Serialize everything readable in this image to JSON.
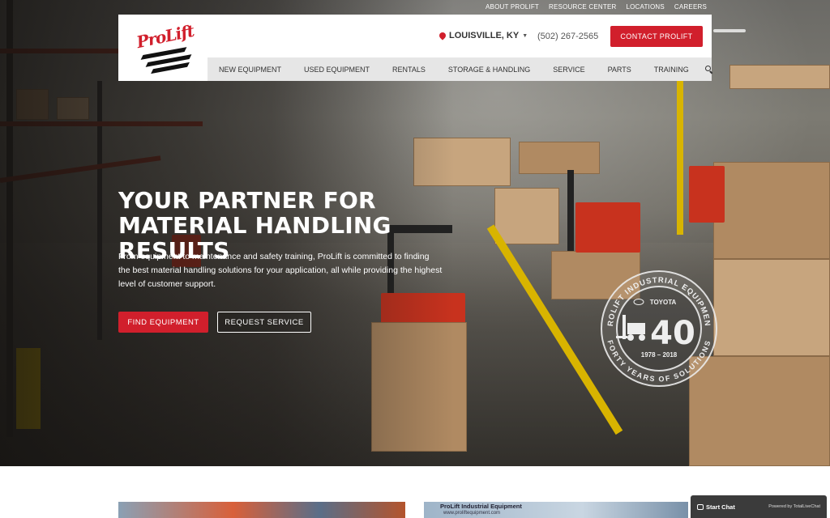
{
  "utility_nav": [
    "ABOUT PROLIFT",
    "RESOURCE CENTER",
    "LOCATIONS",
    "CAREERS"
  ],
  "logo": {
    "text": "ProLift"
  },
  "location": {
    "city": "LOUISVILLE, KY",
    "phone": "(502) 267-2565"
  },
  "header": {
    "contact_label": "CONTACT PROLIFT"
  },
  "main_nav": [
    "NEW EQUIPMENT",
    "USED EQUIPMENT",
    "RENTALS",
    "STORAGE & HANDLING",
    "SERVICE",
    "PARTS",
    "TRAINING"
  ],
  "hero": {
    "headline": "YOUR PARTNER FOR MATERIAL HANDLING RESULTS",
    "intro": "From equipment to maintenance and safety training, ProLift is committed to finding the best material handling solutions for your application, all while providing the highest level of customer support.",
    "primary_cta": "FIND EQUIPMENT",
    "secondary_cta": "REQUEST SERVICE"
  },
  "badge": {
    "top_arc": "PROLIFT INDUSTRIAL EQUIPMENT",
    "bottom_arc": "FORTY YEARS OF SOLUTIONS",
    "brand": "TOYOTA",
    "number": "40",
    "years": "1978 – 2018"
  },
  "cards": [
    {
      "title": ""
    },
    {
      "title": "ProLift Industrial Equipment",
      "subtitle": "www.proliftequipment.com"
    }
  ],
  "chat": {
    "start_label": "Start Chat",
    "powered_by": "Powered by TotalLiveChat"
  },
  "colors": {
    "brand_red": "#d11f2c",
    "nav_gray": "#e6e6e6"
  }
}
